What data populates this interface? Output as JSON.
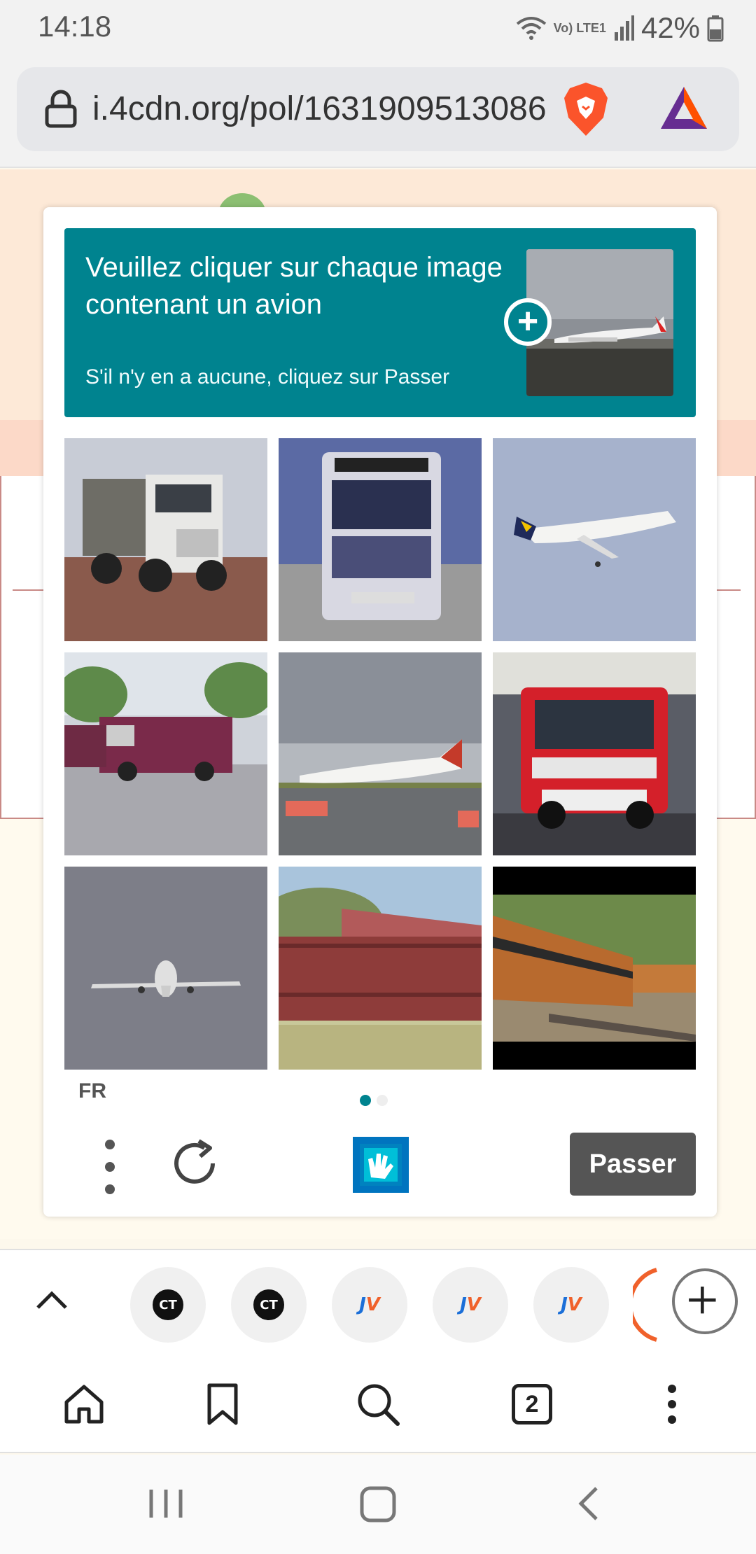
{
  "status_bar": {
    "time": "14:18",
    "network_label": "Vo) LTE1",
    "battery_percent": "42%",
    "icons": [
      "wifi-icon",
      "signal-icon",
      "battery-icon"
    ]
  },
  "browser": {
    "url": "i.4cdn.org/pol/1631909513086",
    "icons": [
      "lock-icon",
      "brave-shields-icon",
      "bat-rewards-icon"
    ]
  },
  "captcha": {
    "prompt_title": "Veuillez cliquer sur chaque image contenant un avion",
    "prompt_subtitle": "S'il n'y en a aucune, cliquez sur Passer",
    "example_image": "airplane-on-runway",
    "grid": [
      {
        "subject": "white dump truck"
      },
      {
        "subject": "truck front view"
      },
      {
        "subject": "airplane in flight"
      },
      {
        "subject": "fire trucks parked"
      },
      {
        "subject": "airplane on runway"
      },
      {
        "subject": "red fire truck"
      },
      {
        "subject": "airplane landing"
      },
      {
        "subject": "freight train wagons"
      },
      {
        "subject": "passenger train"
      }
    ],
    "language": "FR",
    "pages": 2,
    "current_page": 1,
    "skip_label": "Passer",
    "accent_color": "#00838f"
  },
  "tab_strip": {
    "tabs": [
      "ct-tab",
      "ct-tab",
      "jv-tab",
      "jv-tab",
      "jv-tab"
    ],
    "ct_text": "CT",
    "jv_j": "J",
    "jv_v": "V"
  },
  "bottom_nav": {
    "tab_count": "2",
    "items": [
      "home-icon",
      "bookmark-icon",
      "search-icon",
      "tabs-button",
      "more-icon"
    ]
  },
  "system_nav": {
    "items": [
      "recent-apps-icon",
      "home-button-icon",
      "back-icon"
    ]
  }
}
